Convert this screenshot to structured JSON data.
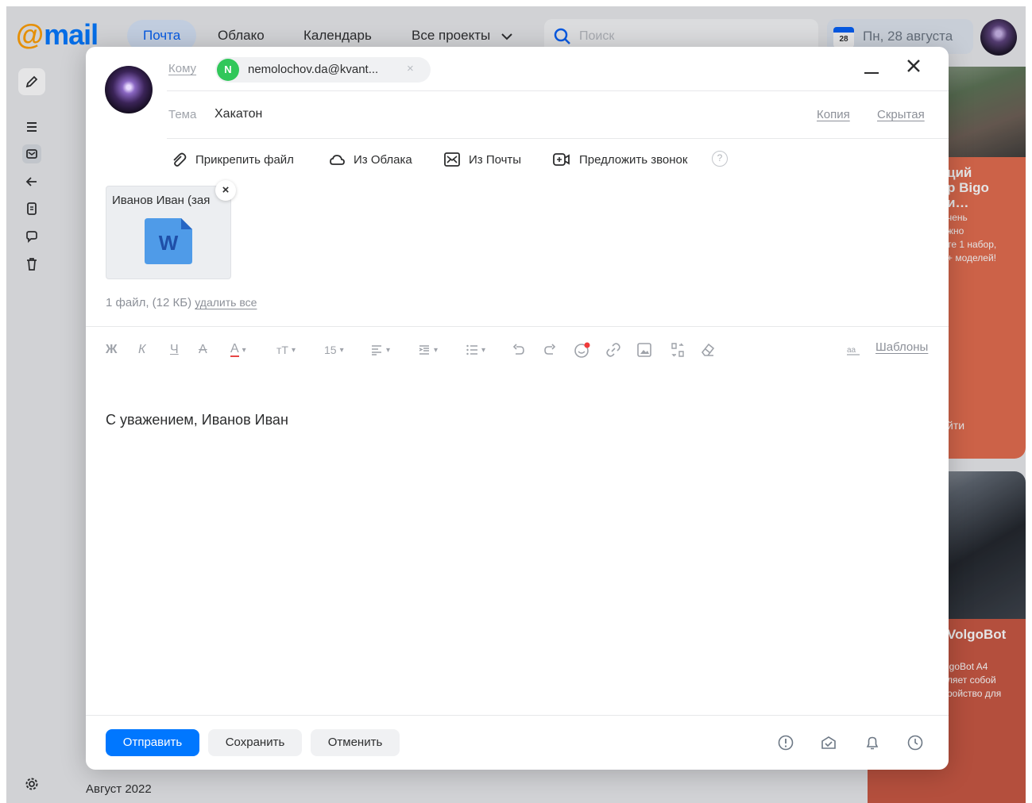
{
  "topbar": {
    "logo_at": "@",
    "logo_word": "mail",
    "nav": [
      "Почта",
      "Облако",
      "Календарь",
      "Все проекты"
    ],
    "search_placeholder": "Поиск",
    "calendar_day": "28",
    "date": "Пн, 28 августа"
  },
  "leftbar": {
    "month": "Август 2022"
  },
  "ads": {
    "ad1_title": "ций\np Bigo\nи…",
    "ad1_text": "чень\nжно\nте 1 набор,\n+ моделей!",
    "ad1_button": "йти",
    "ad2_title": "VolgoBot",
    "ad2_text": "lgoBot A4\nляет собой\nройство для"
  },
  "compose": {
    "to_label": "Кому",
    "recipient_initial": "N",
    "recipient": "nemolochov.da@kvant...",
    "recipient_remove": "×",
    "subject_label": "Тема",
    "subject": "Хакатон",
    "cc": "Копия",
    "bcc": "Скрытая",
    "attach_file": "Прикрепить файл",
    "from_cloud": "Из Облака",
    "from_mail": "Из Почты",
    "propose_call": "Предложить звонок",
    "help": "?",
    "attachment_name": "Иванов Иван (зая",
    "attachment_remove": "×",
    "attach_summary": "1 файл, (12 КБ)",
    "delete_all": "удалить все",
    "fmt_bold": "Ж",
    "fmt_italic": "К",
    "fmt_underline": "Ч",
    "fmt_strike": "А",
    "fmt_color": "А",
    "fmt_size_icon": "тТ",
    "fmt_font_size": "15",
    "templates": "Шаблоны",
    "body": "С уважением, Иванов Иван",
    "send": "Отправить",
    "save": "Сохранить",
    "cancel": "Отменить"
  },
  "colors": {
    "accent": "#0077ff",
    "logo_at": "#ff9e00",
    "recipient_avatar": "#31c75a"
  }
}
